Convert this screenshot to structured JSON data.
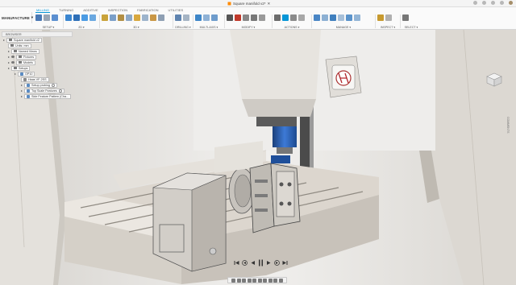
{
  "title_bar": {
    "document_title": "Square manifold v2*"
  },
  "workspace": {
    "label": "MANUFACTURE"
  },
  "tabs": [
    {
      "label": "MILLING",
      "active": true
    },
    {
      "label": "TURNING",
      "active": false
    },
    {
      "label": "ADDITIVE",
      "active": false
    },
    {
      "label": "INSPECTION",
      "active": false
    },
    {
      "label": "FABRICATION",
      "active": false
    },
    {
      "label": "UTILITIES",
      "active": false
    }
  ],
  "ribbon_groups": [
    {
      "label": "SETUP ▾"
    },
    {
      "label": "2D ▾"
    },
    {
      "label": "3D ▾"
    },
    {
      "label": "DRILLING ▾"
    },
    {
      "label": "MULTI-AXIS ▾"
    },
    {
      "label": "MODIFY ▾"
    },
    {
      "label": "ACTIONS ▾"
    },
    {
      "label": "MANAGE ▾"
    },
    {
      "label": "INSPECT ▾"
    },
    {
      "label": "SELECT ▾"
    }
  ],
  "browser": {
    "header": "BROWSER",
    "items": [
      {
        "label": "Square manifold v2"
      },
      {
        "label": "Units: mm"
      },
      {
        "label": "Named Views"
      },
      {
        "label": "Fixtures"
      },
      {
        "label": "Models"
      },
      {
        "label": "Setups"
      },
      {
        "label": "OP10"
      },
      {
        "label": "Haas VF-2SS"
      },
      {
        "label": "Setup probing"
      },
      {
        "label": "Top Scale Features"
      },
      {
        "label": "Side Feature Pattern (Cha..."
      }
    ]
  },
  "side_panel": {
    "label": "COMMENTS"
  },
  "colors": {
    "accent": "#0696d7",
    "machine_body": "#e6e2dc",
    "table": "#dcd6ce"
  }
}
